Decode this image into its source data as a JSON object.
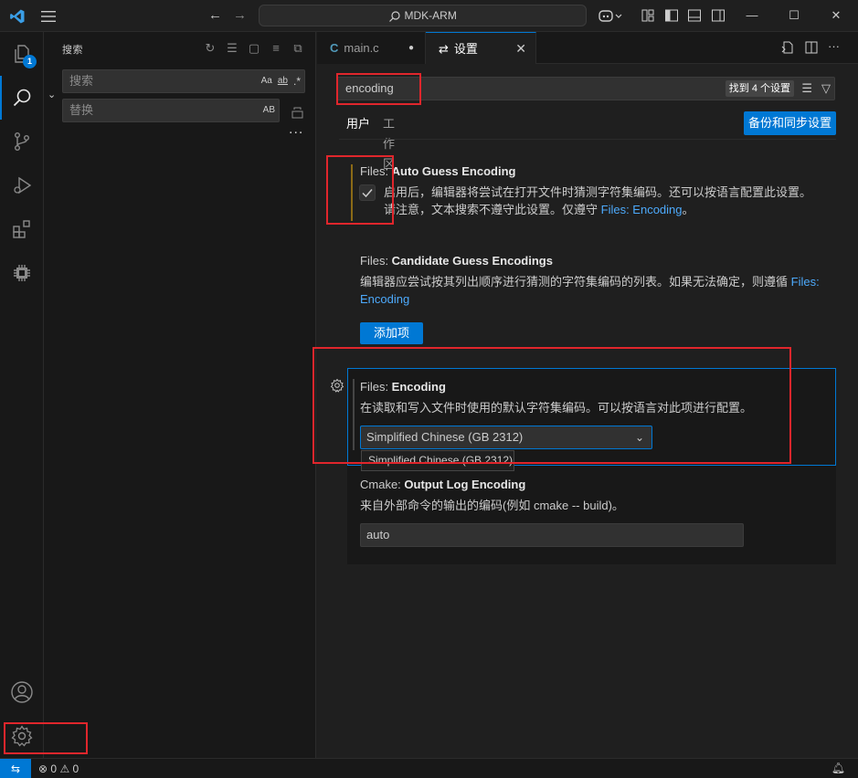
{
  "titlebar": {
    "search_text": "MDK-ARM",
    "icons": [
      "vscode-logo",
      "menu-icon",
      "arrow-left-icon",
      "arrow-right-icon",
      "search-icon",
      "copilot-icon",
      "layout-icon",
      "toggle-sidebar-icon",
      "toggle-panel-icon",
      "toggle-secondary-sidebar-icon",
      "minimize-icon",
      "maximize-icon",
      "close-icon"
    ]
  },
  "activitybar": {
    "explorer_badge": "1",
    "items": [
      "files-icon",
      "search-icon",
      "source-control-icon",
      "run-debug-icon",
      "extensions-icon",
      "chip-icon"
    ],
    "bottom": [
      "account-icon",
      "gear-icon"
    ]
  },
  "sidebar": {
    "title": "搜索",
    "search_placeholder": "搜索",
    "replace_placeholder": "替换",
    "search_opts": [
      "Aa",
      "ab",
      ".*"
    ],
    "replace_opts": [
      "AB"
    ],
    "more": "..."
  },
  "tabs": [
    {
      "label": "main.c",
      "icon": "C"
    },
    {
      "label": "设置"
    }
  ],
  "settings": {
    "search_value": "encoding",
    "found_count": "找到 4 个设置",
    "scope_user": "用户",
    "scope_workspace": "工作区",
    "backup_button": "备份和同步设置",
    "items": [
      {
        "category": "Files: ",
        "name": "Auto Guess Encoding",
        "desc_line1": "启用后，编辑器将尝试在打开文件时猜测字符集编码。还可以按语言配置此设置。",
        "desc_line2_pre": "请注意，文本搜索不遵守此设置。仅遵守 ",
        "desc_link": "Files: Encoding",
        "desc_line2_post": "。",
        "checked": true
      },
      {
        "category": "Files: ",
        "name": "Candidate Guess Encodings",
        "desc_pre": "编辑器应尝试按其列出顺序进行猜测的字符集编码的列表。如果无法确定，则遵循 ",
        "desc_link": "Files: Encoding",
        "add_button": "添加项"
      },
      {
        "category": "Files: ",
        "name": "Encoding",
        "desc": "在读取和写入文件时使用的默认字符集编码。可以按语言对此项进行配置。",
        "select_value": "Simplified Chinese (GB 2312)",
        "dropdown_hover": "Simplified Chinese (GB 2312)"
      },
      {
        "category": "Cmake: ",
        "name": "Output Log Encoding",
        "desc": "来自外部命令的输出的编码(例如 cmake -- build)。",
        "value": "auto"
      }
    ]
  },
  "statusbar": {
    "errors": "0",
    "warnings": "0"
  },
  "colors": {
    "accent": "#0078d4",
    "annotation_red": "#e0262c",
    "modified_bar": "#8b6a16"
  }
}
